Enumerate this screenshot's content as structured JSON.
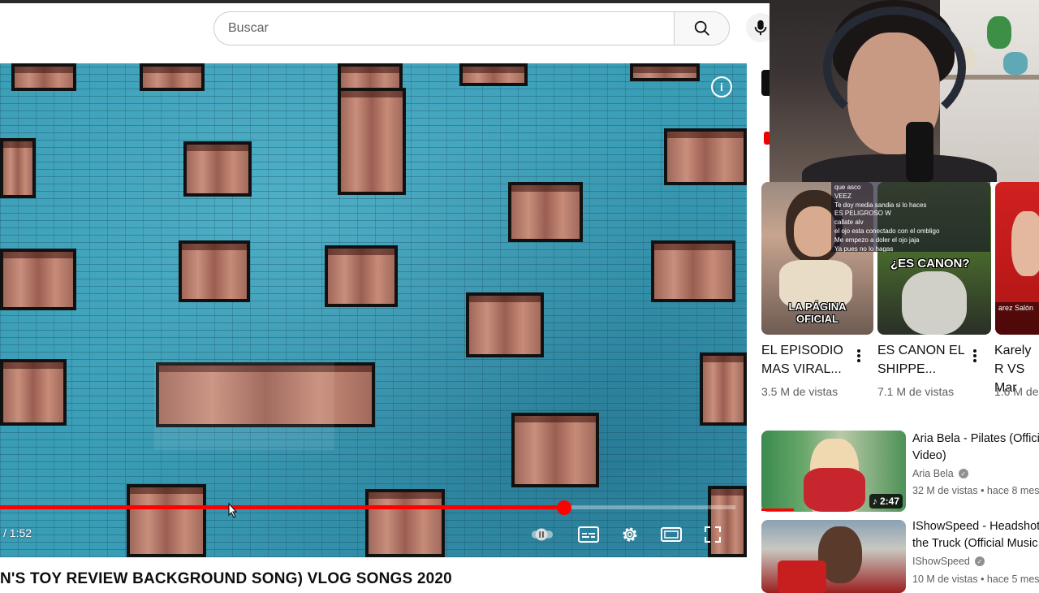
{
  "search": {
    "placeholder": "Buscar"
  },
  "player": {
    "time_display": "/ 1:52",
    "progress": 0.767
  },
  "video": {
    "title": "N'S TOY REVIEW BACKGROUND SONG) VLOG SONGS 2020"
  },
  "overlay_chat": {
    "lines": [
      "que asco",
      "VEEZ",
      "Te doy media sandia si lo haces",
      "ES PELIGROSO W",
      "callate alv",
      "el ojo esta conectado con el ombligo",
      "Me empezo a doler el ojo jaja",
      "Ya pues no lo hagas"
    ]
  },
  "shorts": [
    {
      "title": "EL EPISODIO MAS VIRAL...",
      "views": "3.5 M de vistas",
      "caption": "LA PÁGINA OFICIAL"
    },
    {
      "title": "ES CANON EL SHIPPE...",
      "views": "7.1 M de vistas",
      "caption": "¿ES CANON?"
    },
    {
      "title": "Karely R VS Mar",
      "views": "1.6 M de",
      "caption": "arez Salón"
    }
  ],
  "recommended": [
    {
      "title": "Aria Bela - Pilates (Official Video)",
      "channel": "Aria Bela",
      "meta": "32 M de vistas • hace 8 meses",
      "duration": "♪ 2:47"
    },
    {
      "title": "IShowSpeed - Headshot the Truck (Official Music",
      "channel": "IShowSpeed",
      "meta": "10 M de vistas • hace 5 meses"
    }
  ],
  "colors": {
    "accent": "#ff0000",
    "text": "#0f0f0f",
    "secondary": "#606060"
  }
}
